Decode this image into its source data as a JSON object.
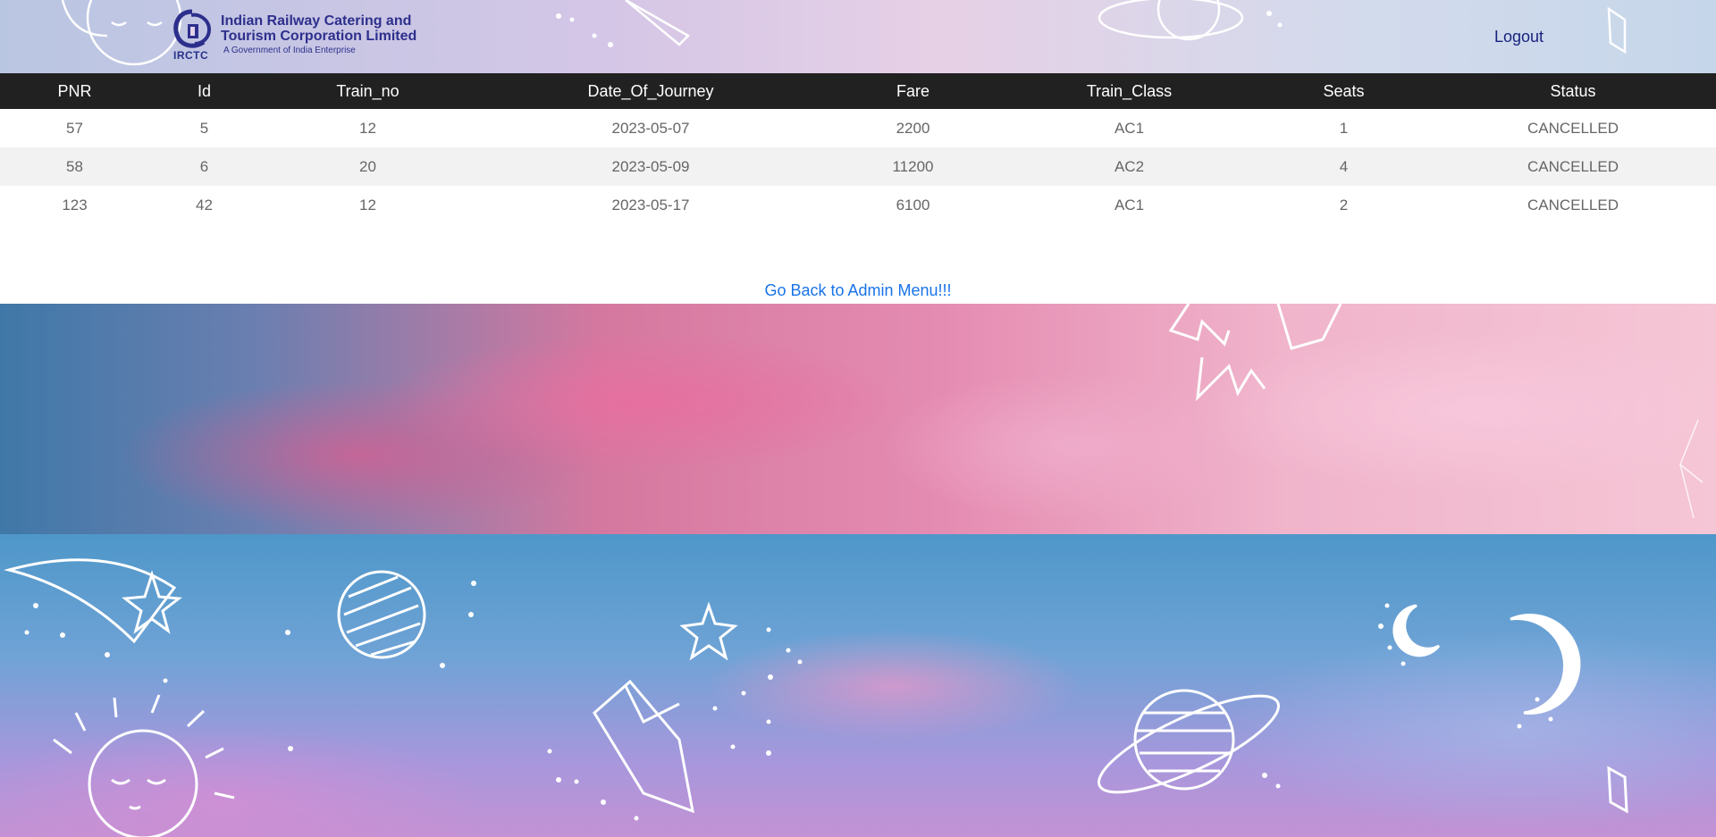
{
  "header": {
    "logo_abbr": "IRCTC",
    "logo_name": "Indian Railway Catering and Tourism Corporation Limited",
    "logo_tagline": "A Government of India Enterprise",
    "logout_label": "Logout"
  },
  "table": {
    "columns": [
      "PNR",
      "Id",
      "Train_no",
      "Date_Of_Journey",
      "Fare",
      "Train_Class",
      "Seats",
      "Status"
    ],
    "rows": [
      [
        "57",
        "5",
        "12",
        "2023-05-07",
        "2200",
        "AC1",
        "1",
        "CANCELLED"
      ],
      [
        "58",
        "6",
        "20",
        "2023-05-09",
        "11200",
        "AC2",
        "4",
        "CANCELLED"
      ],
      [
        "123",
        "42",
        "12",
        "2023-05-17",
        "6100",
        "AC1",
        "2",
        "CANCELLED"
      ]
    ]
  },
  "back_link": "Go Back to Admin Menu!!!",
  "colors": {
    "table_header_bg": "#212121",
    "link": "#1a73e8",
    "brand": "#2d2f8c"
  }
}
